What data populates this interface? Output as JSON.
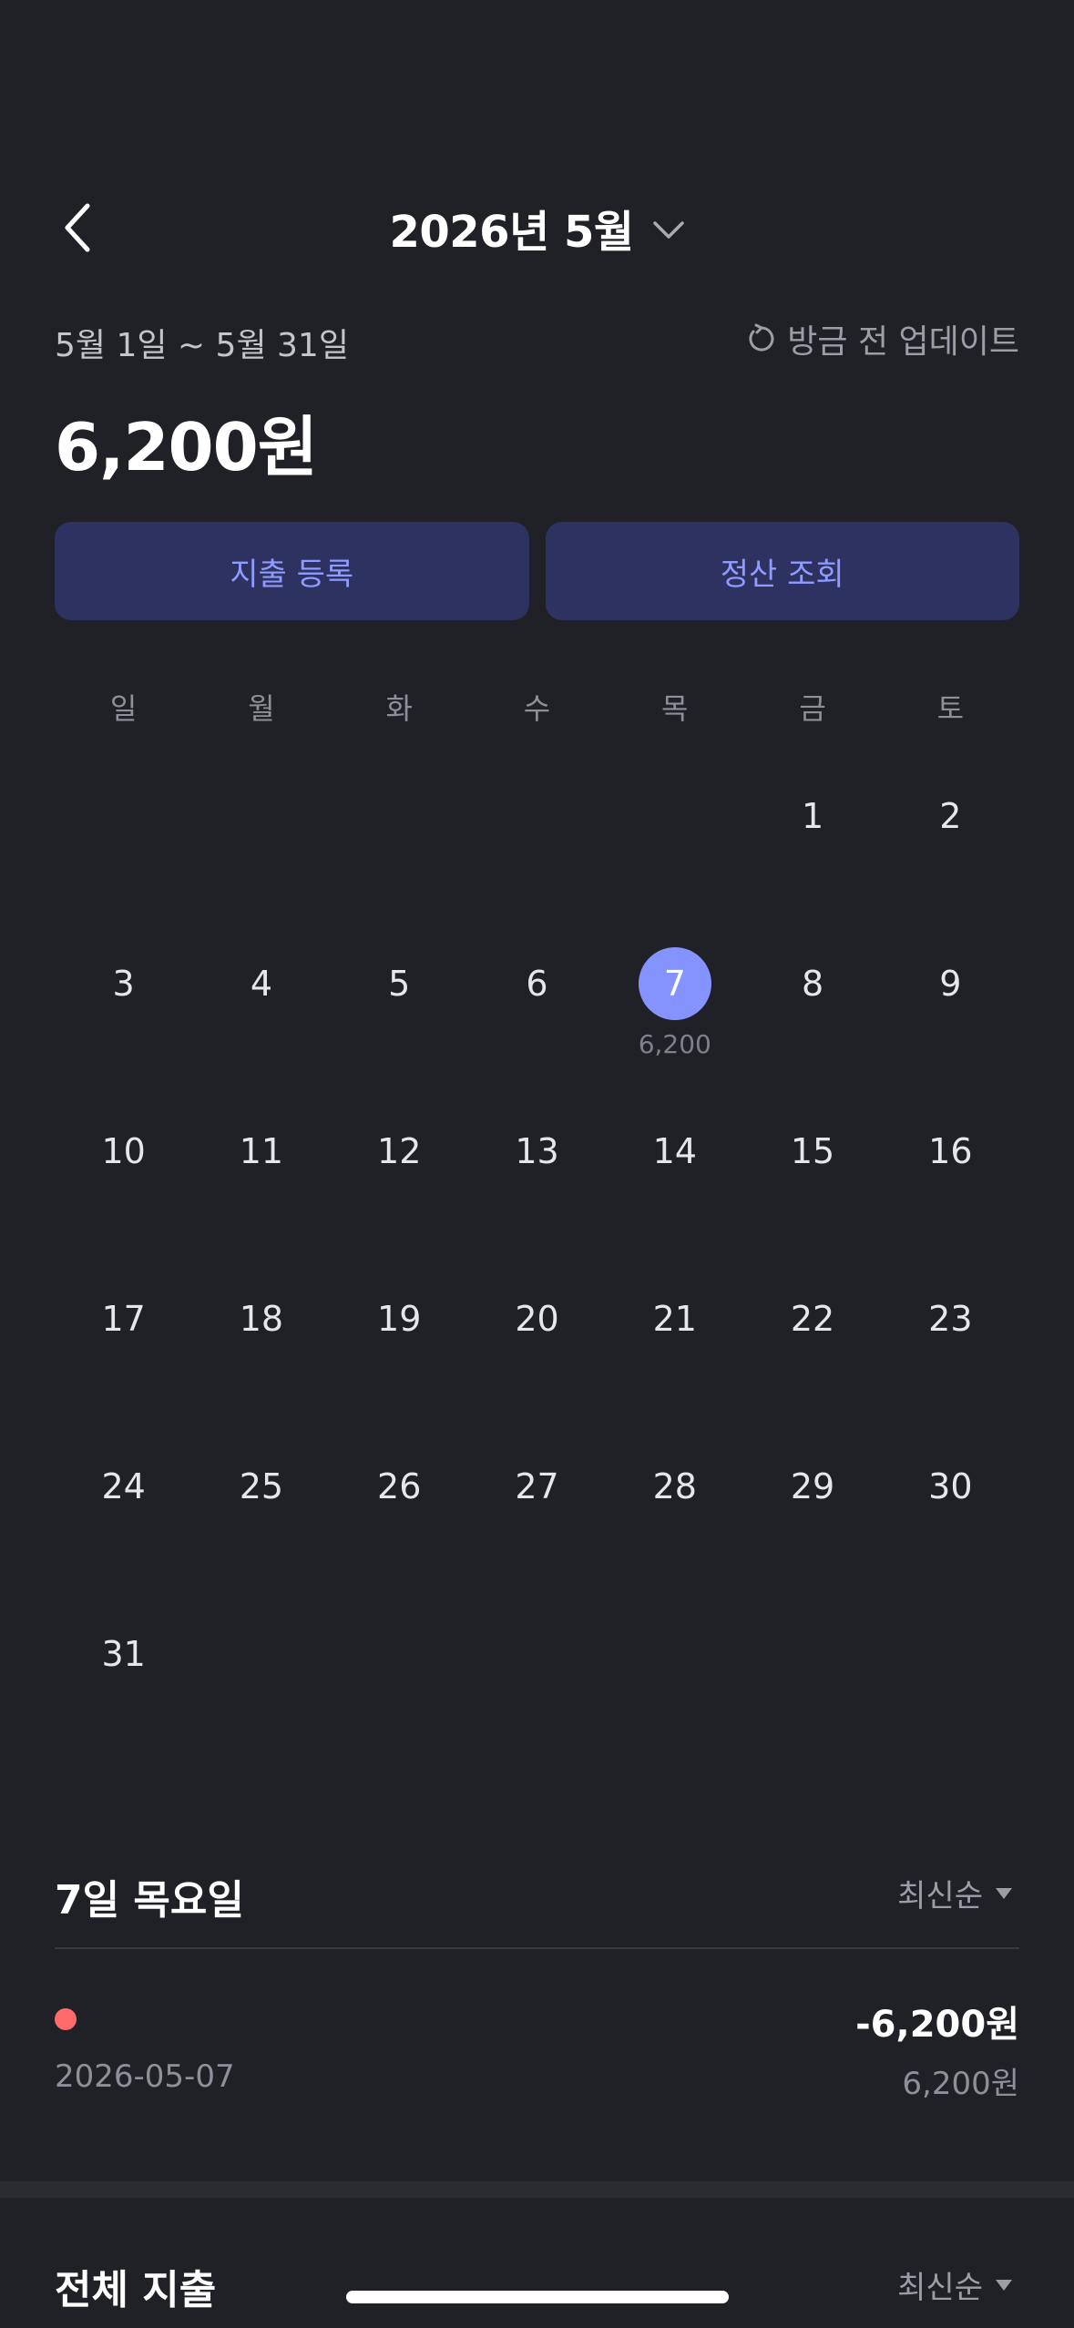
{
  "header": {
    "title": "2026년 5월"
  },
  "summary": {
    "period": "5월 1일 ~ 5월 31일",
    "updated": "방금 전 업데이트",
    "total": "6,200원"
  },
  "actions": {
    "register": "지출 등록",
    "settlement": "정산 조회"
  },
  "calendar": {
    "weekdays": [
      "일",
      "월",
      "화",
      "수",
      "목",
      "금",
      "토"
    ],
    "selected_day": "7",
    "selected_amount": "6,200"
  },
  "day_section": {
    "title": "7일 목요일",
    "sort": "최신순",
    "transaction": {
      "date": "2026-05-07",
      "amount": "-6,200원",
      "sub_amount": "6,200원",
      "dot_color": "#ff6b6b"
    }
  },
  "all_section": {
    "title": "전체 지출",
    "sort": "최신순"
  },
  "colors": {
    "accent": "#8593ff",
    "button_bg": "#2d3260",
    "background": "#202127"
  }
}
